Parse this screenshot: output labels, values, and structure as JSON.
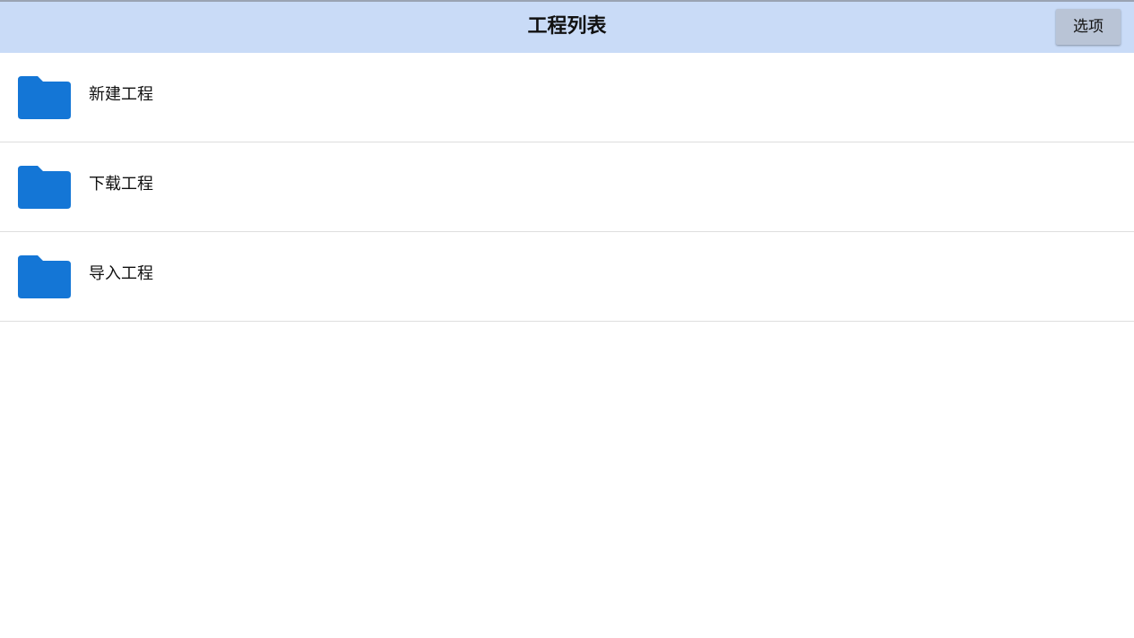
{
  "header": {
    "title": "工程列表",
    "options_label": "选项"
  },
  "list": {
    "items": [
      {
        "label": "新建工程",
        "icon": "folder-icon"
      },
      {
        "label": "下载工程",
        "icon": "folder-icon"
      },
      {
        "label": "导入工程",
        "icon": "folder-icon"
      }
    ]
  },
  "colors": {
    "header_bg": "#c9dbf7",
    "button_bg": "#b9c4d6",
    "folder": "#1476d6"
  }
}
